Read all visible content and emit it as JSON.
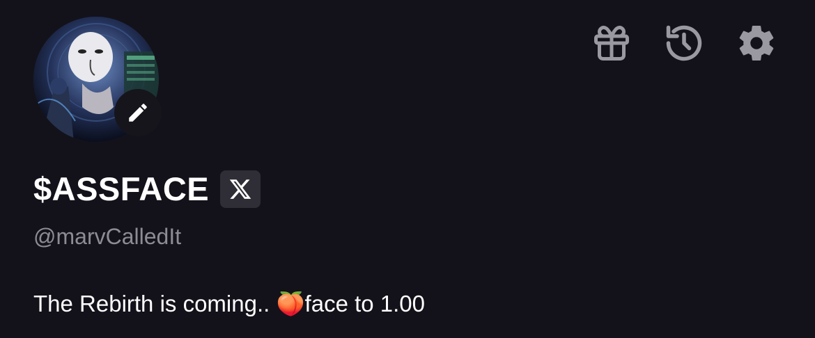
{
  "profile": {
    "display_name": "$ASSFACE",
    "handle": "@marvCalledIt",
    "bio": "The Rebirth is coming.. 🍑face to 1.00"
  },
  "icons": {
    "gift": "gift-icon",
    "history": "history-icon",
    "settings": "gear-icon",
    "edit": "pencil-icon",
    "x": "x-logo-icon"
  },
  "colors": {
    "background": "#13121a",
    "icon_gray": "#9a99a1",
    "handle_gray": "#8d8c94",
    "badge_bg": "#2f2e36"
  }
}
